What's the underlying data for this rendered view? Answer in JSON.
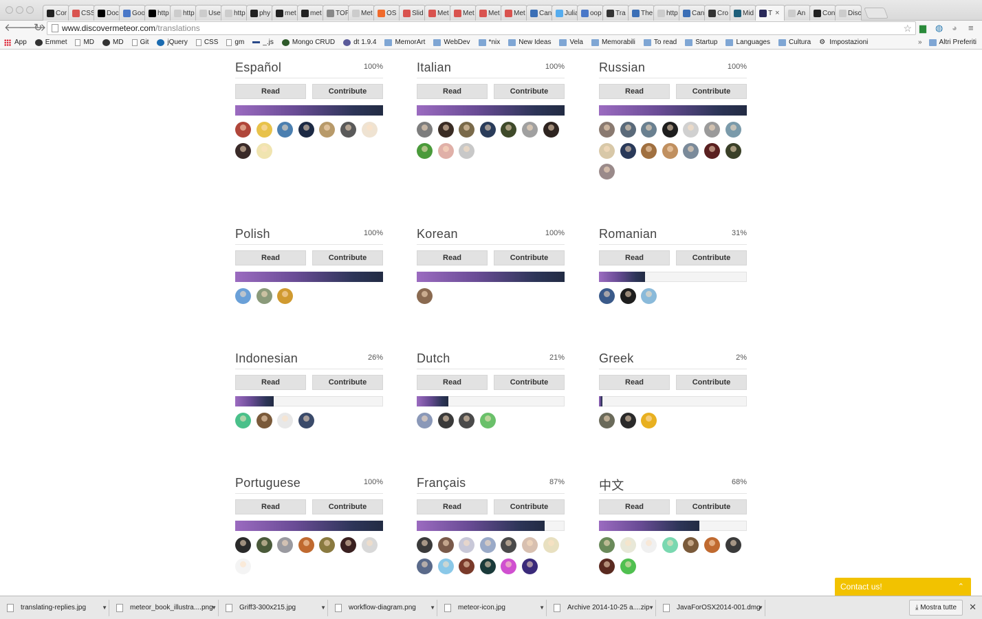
{
  "browser": {
    "url_host": "www.discovermeteor.com",
    "url_path": "/translations",
    "tabs": [
      {
        "label": "Cor",
        "color": "#222222"
      },
      {
        "label": "CSS",
        "color": "#d9534f"
      },
      {
        "label": "Doc",
        "color": "#000000"
      },
      {
        "label": "Goo",
        "color": "#4a78c8"
      },
      {
        "label": "http",
        "color": "#000000"
      },
      {
        "label": "http",
        "color": "#cccccc"
      },
      {
        "label": "Use",
        "color": "#cccccc"
      },
      {
        "label": "http",
        "color": "#cccccc"
      },
      {
        "label": "phy",
        "color": "#222222"
      },
      {
        "label": "met",
        "color": "#222222"
      },
      {
        "label": "met",
        "color": "#222222"
      },
      {
        "label": "TOF",
        "color": "#888888"
      },
      {
        "label": "Met",
        "color": "#cccccc"
      },
      {
        "label": "OS",
        "color": "#f06a2b"
      },
      {
        "label": "Slid",
        "color": "#d9534f"
      },
      {
        "label": "Met",
        "color": "#d9534f"
      },
      {
        "label": "Met",
        "color": "#d9534f"
      },
      {
        "label": "Met",
        "color": "#d9534f"
      },
      {
        "label": "Met",
        "color": "#d9534f"
      },
      {
        "label": "Can",
        "color": "#3b6fb6"
      },
      {
        "label": "Julia",
        "color": "#55acee"
      },
      {
        "label": "oop",
        "color": "#4a78c8"
      },
      {
        "label": "Tra",
        "color": "#333333"
      },
      {
        "label": "The",
        "color": "#3b6fb6"
      },
      {
        "label": "http",
        "color": "#cccccc"
      },
      {
        "label": "Can",
        "color": "#3b6fb6"
      },
      {
        "label": "Cro",
        "color": "#333333"
      },
      {
        "label": "Mid",
        "color": "#1e5f7a"
      },
      {
        "label": "T",
        "color": "#2a2a5a"
      },
      {
        "label": "An",
        "color": "#cccccc"
      },
      {
        "label": "Con",
        "color": "#222222"
      },
      {
        "label": "Disc",
        "color": "#cccccc"
      }
    ],
    "bookmarks": [
      {
        "label": "App",
        "icon": "apps-grid-icon"
      },
      {
        "label": "Emmet",
        "icon": "emmet-icon"
      },
      {
        "label": "MD",
        "icon": "page-icon"
      },
      {
        "label": "MD",
        "icon": "md-icon"
      },
      {
        "label": "Git",
        "icon": "page-icon"
      },
      {
        "label": "jQuery",
        "icon": "jquery-icon"
      },
      {
        "label": "CSS",
        "icon": "page-icon"
      },
      {
        "label": "gm",
        "icon": "page-icon"
      },
      {
        "label": "_.js",
        "icon": "underscore-icon"
      },
      {
        "label": "Mongo CRUD",
        "icon": "mongo-icon"
      },
      {
        "label": "dt 1.9.4",
        "icon": "datatables-icon"
      },
      {
        "label": "MemorArt",
        "icon": "folder-icon"
      },
      {
        "label": "WebDev",
        "icon": "folder-icon"
      },
      {
        "label": "*nix",
        "icon": "folder-icon"
      },
      {
        "label": "New Ideas",
        "icon": "folder-icon"
      },
      {
        "label": "Vela",
        "icon": "folder-icon"
      },
      {
        "label": "Memorabili",
        "icon": "folder-icon"
      },
      {
        "label": "To read",
        "icon": "folder-icon"
      },
      {
        "label": "Startup",
        "icon": "folder-icon"
      },
      {
        "label": "Languages",
        "icon": "folder-icon"
      },
      {
        "label": "Cultura",
        "icon": "folder-icon"
      },
      {
        "label": "Impostazioni",
        "icon": "gear-icon"
      }
    ],
    "bookmarks_more": "»",
    "other_bookmarks": "Altri Preferiti"
  },
  "buttons": {
    "read": "Read",
    "contribute": "Contribute"
  },
  "languages": [
    {
      "name": "Español",
      "percent": "100%",
      "progress": 1.0,
      "avatars": [
        "#b0463a",
        "#e8c24a",
        "#4b7fb0",
        "#1d2a44",
        "#b89a6a",
        "#5a5a5a",
        "#efe3d2",
        "#3a2a28",
        "#f0e4b0"
      ]
    },
    {
      "name": "Italian",
      "percent": "100%",
      "progress": 1.0,
      "avatars": [
        "#7d7d7d",
        "#3a2c24",
        "#7a6a4a",
        "#2a3c5a",
        "#3f4a2a",
        "#a0a0a0",
        "#2e2420",
        "#4a9a3a",
        "#e0b0a8",
        "#c8c8c8"
      ]
    },
    {
      "name": "Russian",
      "percent": "100%",
      "progress": 1.0,
      "avatars": [
        "#8a7a70",
        "#5a6a7a",
        "#6a8090",
        "#1e1e1e",
        "#d0d0d0",
        "#9a9a9a",
        "#7a9aaa",
        "#d8c8a8",
        "#2a3a5a",
        "#a07040",
        "#c09060",
        "#7a8a9a",
        "#5a2020",
        "#3a4028",
        "#9a8a8a"
      ]
    },
    {
      "name": "Polish",
      "percent": "100%",
      "progress": 1.0,
      "avatars": [
        "#6aa0d8",
        "#8a9a7a",
        "#d09a30"
      ]
    },
    {
      "name": "Korean",
      "percent": "100%",
      "progress": 1.0,
      "avatars": [
        "#8a6a50"
      ]
    },
    {
      "name": "Romanian",
      "percent": "31%",
      "progress": 0.31,
      "avatars": [
        "#3a5a8a",
        "#1e1e1e",
        "#8abada"
      ]
    },
    {
      "name": "Indonesian",
      "percent": "26%",
      "progress": 0.26,
      "avatars": [
        "#4ac08a",
        "#7a5a3a",
        "#e8e8e8",
        "#3a4a6a"
      ]
    },
    {
      "name": "Dutch",
      "percent": "21%",
      "progress": 0.21,
      "avatars": [
        "#8a98b8",
        "#3a3a3a",
        "#4a4a4a",
        "#6ac06a"
      ]
    },
    {
      "name": "Greek",
      "percent": "2%",
      "progress": 0.02,
      "avatars": [
        "#6a6a5a",
        "#2a2a2a",
        "#e8b020"
      ]
    },
    {
      "name": "Portuguese",
      "percent": "100%",
      "progress": 1.0,
      "avatars": [
        "#2a2a2a",
        "#4a5a3a",
        "#9a9aa0",
        "#c06a30",
        "#8a7a40",
        "#3a2020",
        "#d8d8d8",
        "#f4f4f4"
      ]
    },
    {
      "name": "Français",
      "percent": "87%",
      "progress": 0.87,
      "avatars": [
        "#3a3a3a",
        "#7a5a4a",
        "#c8c8d8",
        "#9aaac8",
        "#4a4a4a",
        "#d8c0b0",
        "#e8e0c0",
        "#5a6a8a",
        "#8ac8e8",
        "#7a3a2a",
        "#1a3a3a",
        "#d050d0",
        "#3a2a7a"
      ]
    },
    {
      "name": "中文",
      "percent": "68%",
      "progress": 0.68,
      "avatars": [
        "#6a8a5a",
        "#e8e8d8",
        "#f0f0f0",
        "#7ad8b0",
        "#7a5a3a",
        "#c06a30",
        "#3a3a3a",
        "#5a2a20",
        "#50c050"
      ]
    }
  ],
  "contact": {
    "label": "Contact us!",
    "chevron": "⌃"
  },
  "downloads": {
    "items": [
      "translating-replies.jpg",
      "meteor_book_illustra....png",
      "Griff3-300x215.jpg",
      "workflow-diagram.png",
      "meteor-icon.jpg",
      "Archive 2014-10-25 a....zip",
      "JavaForOSX2014-001.dmg"
    ],
    "show_all": "Mostra tutte",
    "close": "✕"
  }
}
